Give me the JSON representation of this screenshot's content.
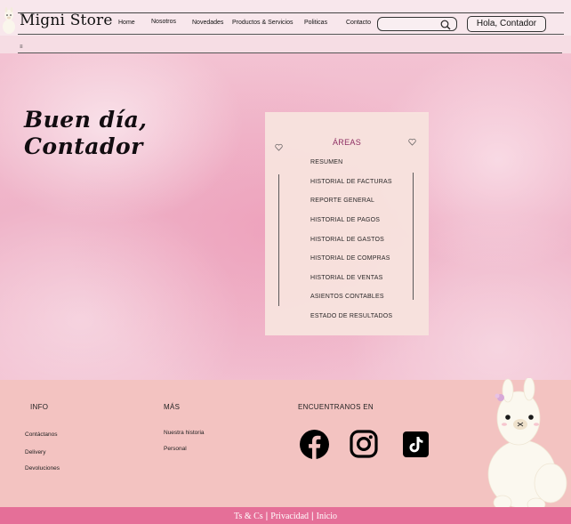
{
  "header": {
    "brand": "Migni Store",
    "nav": [
      "Home",
      "Nosotros",
      "Novedades",
      "Productos & Servicios",
      "Politicas",
      "Contacto"
    ],
    "search": {
      "value": "",
      "placeholder": ""
    },
    "user_button": "Hola, Contador"
  },
  "subbar": {
    "menu_icon": "≡"
  },
  "hero": {
    "greeting_line1": "Buen día,",
    "greeting_line2": "Contador"
  },
  "areas": {
    "title": "ÁREAS",
    "items": [
      "RESUMEN",
      "HISTORIAL DE FACTURAS",
      "REPORTE GENERAL",
      "HISTORIAL DE PAGOS",
      "HISTORIAL DE GASTOS",
      "HISTORIAL DE COMPRAS",
      "HISTORIAL DE VENTAS",
      "ASIENTOS CONTABLES",
      "ESTADO DE RESULTADOS"
    ]
  },
  "footer": {
    "info": {
      "title": "INFO",
      "links": [
        "Contáctanos",
        "Delivery",
        "Devoluciones"
      ]
    },
    "mas": {
      "title": "MÁS",
      "links": [
        "Nuestra historia",
        "Personal"
      ]
    },
    "social": {
      "title": "ENCUENTRANOS EN",
      "icons": [
        "facebook-icon",
        "instagram-icon",
        "tiktok-icon"
      ]
    }
  },
  "bottom_bar": {
    "links": [
      "Ts & Cs",
      "Privacidad",
      "Inicio"
    ]
  },
  "colors": {
    "accent": "#e56f98",
    "footer_bg": "#f3c3c1",
    "card_bg": "#f8e3de",
    "areas_title": "#8b2a60"
  }
}
